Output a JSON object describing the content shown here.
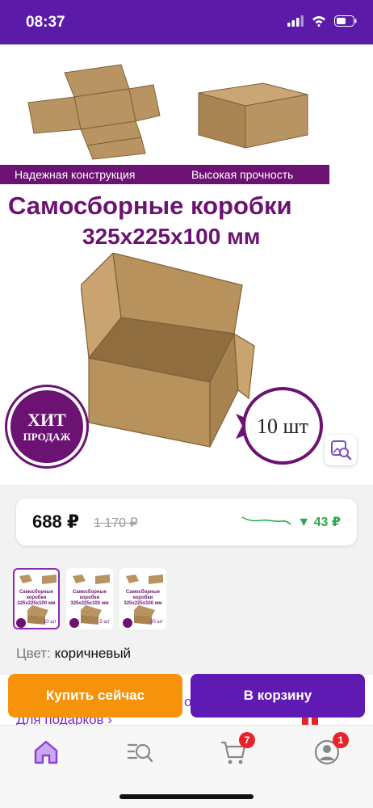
{
  "status_bar": {
    "time": "08:37"
  },
  "hero": {
    "banner_left": "Надежная конструкция",
    "banner_right": "Высокая прочность",
    "title": "Самосборные коробки",
    "size": "325х225х100 мм",
    "hit_line1": "ХИТ",
    "hit_line2": "ПРОДАЖ",
    "qty": "10 шт"
  },
  "price": {
    "current": "688 ₽",
    "old": "1 170 ₽",
    "drop": "▼ 43 ₽"
  },
  "thumbnails": [
    {
      "text": "Самосборные коробки 325х225х100 мм",
      "badge": "10 шт"
    },
    {
      "text": "Самосборные коробки 325х225х100 мм",
      "badge": "5 шт"
    },
    {
      "text": "Самосборные коробки 325х225х100 мм",
      "badge": "20 шт"
    }
  ],
  "color": {
    "label": "Цвет:",
    "value": "коричневый"
  },
  "promo": {
    "text": "Для подарков ›",
    "visible_mark": "о"
  },
  "actions": {
    "buy_now": "Купить сейчас",
    "add_to_cart": "В корзину"
  },
  "tabbar": {
    "cart_badge": "7",
    "profile_badge": "1"
  },
  "colors": {
    "brand": "#5b1aa8",
    "buy": "#f7930a",
    "cart": "#5f1ab3",
    "drop": "#2fa84f",
    "badge": "#e8232b"
  }
}
